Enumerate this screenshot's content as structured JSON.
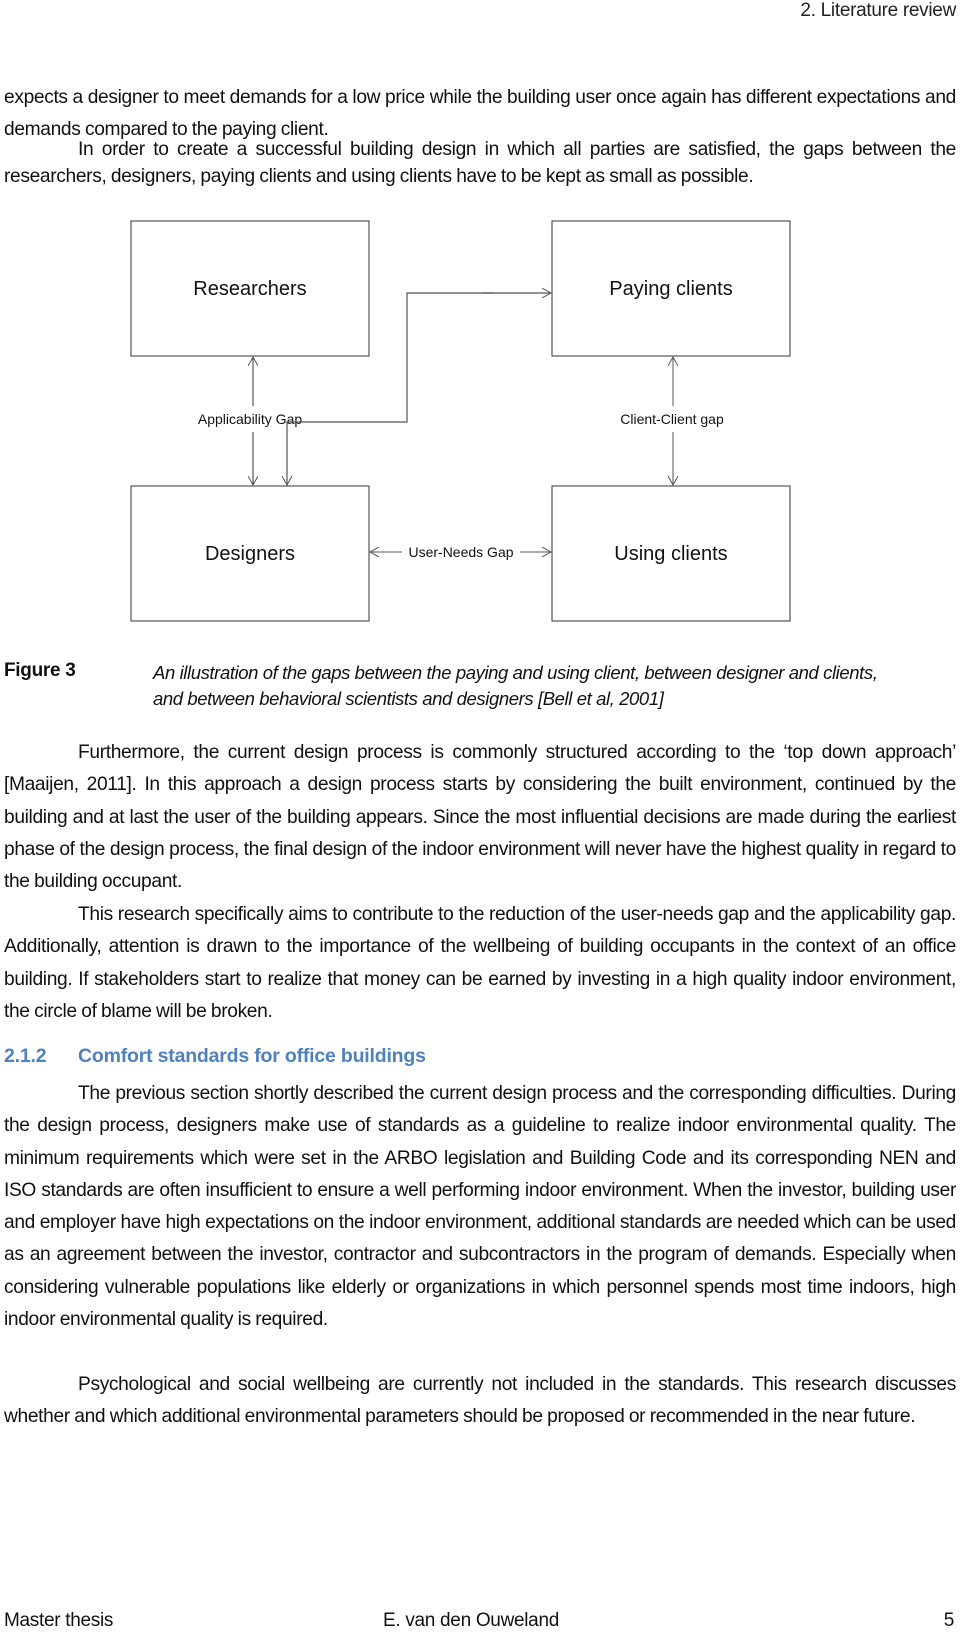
{
  "header": {
    "chapter": "2. Literature review"
  },
  "paragraphs_top": {
    "p1": "expects a designer to meet demands for a low price while the building user once again has different expectations and demands compared to the paying client.",
    "p2": "In order to create a successful building design in which all parties are satisfied, the gaps between the researchers, designers, paying clients and using clients have to be kept as small as possible."
  },
  "diagram": {
    "boxes": {
      "researchers": "Researchers",
      "paying_clients": "Paying clients",
      "designers": "Designers",
      "using_clients": "Using clients"
    },
    "gaps": {
      "applicability": "Applicability Gap",
      "client_client": "Client-Client gap",
      "user_needs": "User-Needs Gap"
    }
  },
  "figure": {
    "label": "Figure 3",
    "caption": "An illustration of the gaps between the paying and using client, between designer and clients, and between behavioral scientists and designers [Bell et al, 2001]"
  },
  "paragraphs_mid": {
    "p3": "Furthermore, the current design process is commonly structured according to the ‘top down approach’ [Maaijen, 2011]. In this approach a design process starts by considering the built environment, continued by the building and at last the user of the building appears. Since the most influential decisions are made during the earliest phase of the design process, the final design of the indoor environment will never have the highest quality in regard to the building occupant.",
    "p4": "This research specifically aims to contribute to the reduction of the user-needs gap and the applicability gap. Additionally, attention is drawn to the importance of the wellbeing of building occupants in the context of an office building. If stakeholders start to realize that money can be earned by investing in a high quality indoor environment, the circle of blame will be broken."
  },
  "section": {
    "number": "2.1.2",
    "title": "Comfort standards for office buildings",
    "color": "#4f81bd"
  },
  "paragraphs_bottom": {
    "p5": "The previous section shortly described the current design process and the corresponding difficulties. During the design process, designers make use of standards as a guideline to realize indoor environmental quality. The minimum requirements which were set in the ARBO legislation and Building Code and its corresponding NEN and ISO standards are often insufficient to ensure a well performing indoor environment. When the investor, building user and employer have high expectations on the indoor environment, additional standards are needed which can be used as an agreement between the investor, contractor and subcontractors in the program of demands. Especially when considering vulnerable populations like elderly or organizations in which personnel spends most time indoors, high indoor environmental quality is required.",
    "p6": "Psychological and social wellbeing are currently not included in the standards. This research discusses whether and which additional environmental parameters should be proposed or recommended in the near future."
  },
  "footer": {
    "left": "Master thesis",
    "center": "E. van den Ouweland",
    "page": "5"
  }
}
